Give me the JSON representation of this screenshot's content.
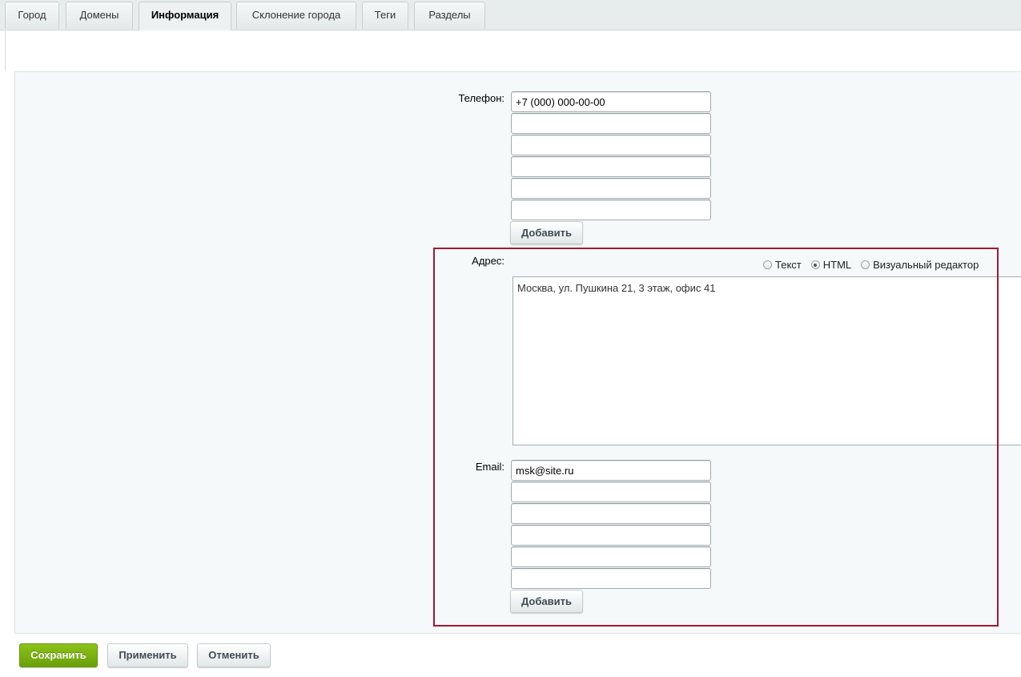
{
  "tabs": [
    {
      "label": "Город",
      "active": false
    },
    {
      "label": "Домены",
      "active": false
    },
    {
      "label": "Информация",
      "active": true
    },
    {
      "label": "Склонение города",
      "active": false
    },
    {
      "label": "Теги",
      "active": false
    },
    {
      "label": "Разделы",
      "active": false
    }
  ],
  "phone": {
    "label": "Телефон:",
    "values": [
      "+7 (000) 000-00-00",
      "",
      "",
      "",
      "",
      ""
    ],
    "add_label": "Добавить"
  },
  "address": {
    "label": "Адрес:",
    "editor_modes": [
      {
        "label": "Текст",
        "checked": false
      },
      {
        "label": "HTML",
        "checked": true
      },
      {
        "label": "Визуальный редактор",
        "checked": false
      }
    ],
    "value": "Москва, ул. Пушкина 21, 3 этаж, офис 41"
  },
  "email": {
    "label": "Email:",
    "values": [
      "msk@site.ru",
      "",
      "",
      "",
      "",
      ""
    ],
    "add_label": "Добавить"
  },
  "footer": {
    "save_label": "Сохранить",
    "apply_label": "Применить",
    "cancel_label": "Отменить"
  },
  "colors": {
    "highlight_border": "#9e1a36",
    "primary_button": "#7bb212"
  }
}
